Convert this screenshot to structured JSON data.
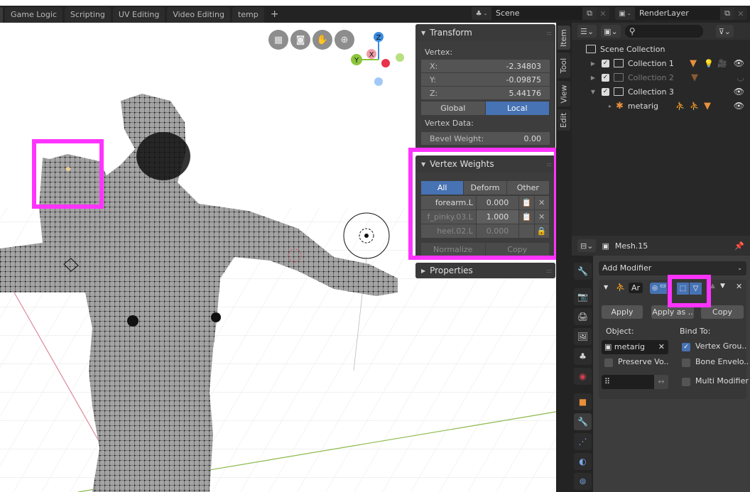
{
  "workspace_tabs": [
    "Game Logic",
    "Scripting",
    "UV Editing",
    "Video Editing",
    "temp"
  ],
  "add_workspace": "+",
  "scene": {
    "label": "Scene",
    "icon": "scene-icon"
  },
  "view_layer": {
    "label": "RenderLayer",
    "icon": "render-layer-icon"
  },
  "viewport": {
    "nav_buttons": [
      "grid-view-icon",
      "camera-icon",
      "hand-pan-icon",
      "zoom-icon"
    ],
    "axes": {
      "z": "Z",
      "x": "X",
      "y": "Y"
    }
  },
  "sidebar_tabs": [
    "Item",
    "Tool",
    "View",
    "Edit"
  ],
  "transform": {
    "title": "Transform",
    "vertex_label": "Vertex:",
    "fields": [
      {
        "key": "X:",
        "value": "-2.34803"
      },
      {
        "key": "Y:",
        "value": "-0.09875"
      },
      {
        "key": "Z:",
        "value": "5.44176"
      }
    ],
    "space": [
      "Global",
      "Local"
    ],
    "space_active": "Local",
    "vertex_data_label": "Vertex Data:",
    "bevel_weight": {
      "key": "Bevel Weight:",
      "value": "0.00"
    }
  },
  "vertex_weights": {
    "title": "Vertex Weights",
    "filters": [
      "All",
      "Deform",
      "Other"
    ],
    "filter_active": "All",
    "rows": [
      {
        "name": "forearm.L",
        "value": "0.000",
        "locked": false
      },
      {
        "name": "f_pinky.03.L",
        "value": "1.000",
        "locked": false
      },
      {
        "name": "heel.02.L",
        "value": "0.000",
        "locked": true
      }
    ],
    "normalize": "Normalize",
    "copy": "Copy"
  },
  "properties_panel_title": "Properties",
  "outliner": {
    "root": "Scene Collection",
    "items": [
      {
        "name": "Collection 1",
        "expanded": false,
        "checked": true,
        "dim": false
      },
      {
        "name": "Collection 2",
        "expanded": false,
        "checked": true,
        "dim": true
      },
      {
        "name": "Collection 3",
        "expanded": true,
        "checked": true,
        "dim": false
      },
      {
        "name": "metarig",
        "child": true
      }
    ]
  },
  "properties": {
    "object_name": "Mesh.15",
    "add_modifier": "Add Modifier",
    "modifier": {
      "short_name": "Ar",
      "apply": "Apply",
      "apply_as": "Apply as ..",
      "copy": "Copy",
      "object_label": "Object:",
      "object_value": "metarig",
      "bind_to_label": "Bind To:",
      "vertex_groups": {
        "label": "Vertex Grou..",
        "checked": true
      },
      "bone_envelopes": {
        "label": "Bone Envelo..",
        "checked": false
      },
      "preserve_volume": {
        "label": "Preserve Vo..",
        "checked": false
      },
      "multi_modifier": {
        "label": "Multi Modifier",
        "checked": false
      },
      "vertex_group_field": ""
    },
    "tabs": [
      "tool-icon",
      "render-icon",
      "output-icon",
      "view-layer-icon",
      "scene-icon",
      "world-icon",
      "object-icon",
      "modifier-icon",
      "particles-icon",
      "physics-icon",
      "constraints-icon"
    ],
    "active_tab": "modifier-icon"
  },
  "colors": {
    "accent": "#4772b3",
    "highlight": "#ff33ff",
    "object_orange": "#e8903c"
  }
}
